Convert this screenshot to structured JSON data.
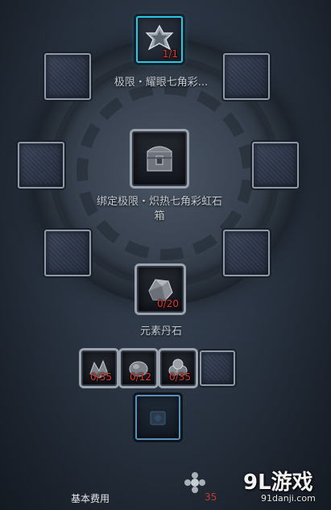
{
  "top_item": {
    "name": "极限・耀眼七角彩...",
    "count": "1/1",
    "icon": "star-gem-icon"
  },
  "center_item": {
    "name_line1": "绑定极限・炽热七角彩虹石",
    "name_line2": "箱",
    "icon": "treasure-chest-icon"
  },
  "material_item": {
    "name": "元素丹石",
    "count": "0/20",
    "icon": "element-stone-icon"
  },
  "sub_materials": [
    {
      "count": "0/35",
      "icon": "crystal-cluster-icon"
    },
    {
      "count": "0/12",
      "icon": "ore-chunk-icon"
    },
    {
      "count": "0/35",
      "icon": "orb-pile-icon"
    },
    {
      "count": "",
      "icon": "empty-slot"
    }
  ],
  "footer": {
    "cost_label": "基本费用",
    "cost_value": "35"
  },
  "watermark": {
    "main": "9L游戏",
    "sub": "91danji.com"
  },
  "colors": {
    "selected_border": "#29c7e6",
    "count_text": "#e03a2c",
    "background": "#2a3442"
  }
}
